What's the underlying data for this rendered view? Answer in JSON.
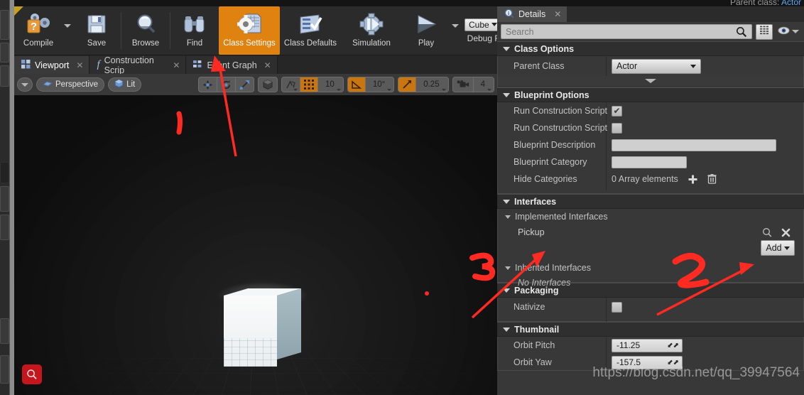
{
  "header": {
    "parent_class_label": "Parent class:",
    "parent_class_value": "Actor"
  },
  "toolbar": {
    "buttons": [
      {
        "label": "Compile",
        "icon": "compile-question-gears-icon",
        "active": false,
        "has_dropdown": true
      },
      {
        "label": "Save",
        "icon": "floppy-disk-icon",
        "active": false,
        "has_dropdown": false
      },
      {
        "label": "Browse",
        "icon": "magnifier-icon",
        "active": false,
        "has_dropdown": false
      },
      {
        "label": "Find",
        "icon": "binoculars-icon",
        "active": false,
        "has_dropdown": false
      },
      {
        "label": "Class Settings",
        "icon": "class-settings-gear-icon",
        "active": true,
        "has_dropdown": false
      },
      {
        "label": "Class Defaults",
        "icon": "class-defaults-checklist-icon",
        "active": false,
        "has_dropdown": false
      },
      {
        "label": "Simulation",
        "icon": "simulation-gear-play-icon",
        "active": false,
        "has_dropdown": false
      },
      {
        "label": "Play",
        "icon": "play-triangle-icon",
        "active": false,
        "has_dropdown": true
      }
    ],
    "debug_filter": {
      "label": "Debug Filter",
      "value": "Cube",
      "search_icon": "search-icon"
    }
  },
  "graph_tabs": [
    {
      "label": "Viewport",
      "icon": "viewport-grid-icon",
      "active": true,
      "closable": true
    },
    {
      "label": "Construction Scrip",
      "icon": "function-f-icon",
      "active": false,
      "closable": true
    },
    {
      "label": "Event Graph",
      "icon": "event-graph-icon",
      "active": false,
      "closable": true
    }
  ],
  "viewport_toolbar": {
    "menu_icon": "chevron-down-icon",
    "camera_mode": "Perspective",
    "camera_icon": "camera-perspective-icon",
    "view_mode": "Lit",
    "view_mode_icon": "lit-cube-icon",
    "transform_tools": [
      "move-tool-icon",
      "rotate-tool-icon",
      "scale-tool-icon"
    ],
    "world_space_icon": "world-space-cube-icon",
    "snap_icons": [
      "surface-snap-icon",
      "grid-snap-icon"
    ],
    "grid_snap_value": "10",
    "rotation_snap_icon": "angle-snap-icon",
    "rotation_snap_value": "10°",
    "scale_snap_icon": "scale-snap-icon",
    "scale_snap_value": "0.25",
    "camera_speed_icon": "camera-speed-icon",
    "camera_speed_value": "4"
  },
  "viewport": {
    "search_button_icon": "search-icon",
    "object": "cube"
  },
  "annotations": [
    {
      "text": "1",
      "note": "red handwritten numeral near top-left of viewport"
    },
    {
      "text": "2",
      "note": "red handwritten numeral pointing at Add button"
    },
    {
      "text": "3",
      "note": "red handwritten numeral pointing at Implemented Interfaces"
    }
  ],
  "details": {
    "tab": {
      "label": "Details",
      "icon": "details-info-icon",
      "close_icon": "close-icon"
    },
    "search": {
      "placeholder": "Search",
      "value": "",
      "icon": "search-icon"
    },
    "grid_view_icon": "grid-view-icon",
    "visibility_icon": "eye-icon",
    "visibility_caret_icon": "chevron-down-icon",
    "sections": {
      "class_options": {
        "title": "Class Options",
        "parent_class": {
          "label": "Parent Class",
          "value": "Actor"
        }
      },
      "blueprint_options": {
        "title": "Blueprint Options",
        "rows": [
          {
            "label": "Run Construction Script o",
            "type": "checkbox",
            "checked": true
          },
          {
            "label": "Run Construction Script i",
            "type": "checkbox",
            "checked": false
          },
          {
            "label": "Blueprint Description",
            "type": "text",
            "value": ""
          },
          {
            "label": "Blueprint Category",
            "type": "text",
            "value": ""
          },
          {
            "label": "Hide Categories",
            "type": "array",
            "value": "0 Array elements",
            "add_icon": "plus-icon",
            "delete_icon": "trash-icon"
          }
        ]
      },
      "interfaces": {
        "title": "Interfaces",
        "implemented_title": "Implemented Interfaces",
        "implemented": [
          {
            "name": "Pickup",
            "browse_icon": "magnifier-icon",
            "remove_icon": "close-x-icon"
          }
        ],
        "add_button": {
          "label": "Add",
          "caret_icon": "chevron-down-icon"
        },
        "inherited_title": "Inherited Interfaces",
        "inherited_empty": "No Interfaces"
      },
      "packaging": {
        "title": "Packaging",
        "rows": [
          {
            "label": "Nativize",
            "type": "checkbox",
            "checked": false
          }
        ]
      },
      "thumbnail": {
        "title": "Thumbnail",
        "rows": [
          {
            "label": "Orbit Pitch",
            "value": "-11.25"
          },
          {
            "label": "Orbit Yaw",
            "value": "-157.5"
          }
        ]
      }
    }
  },
  "watermark": "https://blog.csdn.net/qq_39947564",
  "colors": {
    "accent_orange": "#e08210",
    "panel_bg": "#383838",
    "toolbar_bg": "#2b2b2b",
    "annotation_red": "#ff2a21",
    "link_blue": "#5da9ef"
  }
}
